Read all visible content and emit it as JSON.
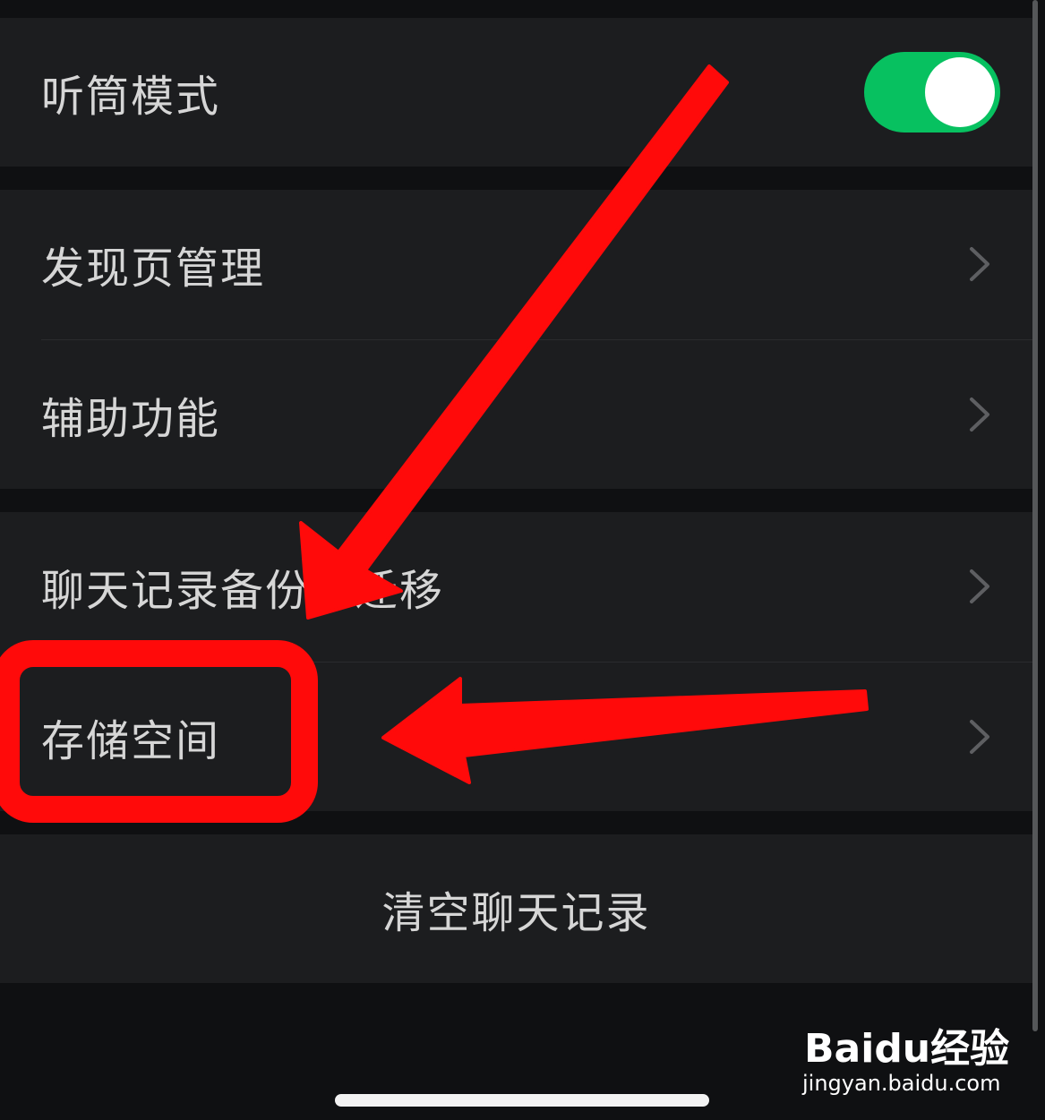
{
  "settings": {
    "earpiece_mode": {
      "label": "听筒模式",
      "toggle_on": true
    },
    "discover_page": {
      "label": "发现页管理"
    },
    "accessibility": {
      "label": "辅助功能"
    },
    "chat_backup": {
      "label": "聊天记录备份与迁移"
    },
    "storage": {
      "label": "存储空间"
    },
    "clear_history": {
      "label": "清空聊天记录"
    }
  },
  "watermark": {
    "logo_prefix": "Bai",
    "logo_paw": "du",
    "logo_suffix": "经验",
    "url": "jingyan.baidu.com"
  },
  "colors": {
    "background": "#0f1012",
    "cell": "#1c1d1f",
    "toggle_on": "#07c160",
    "annotation": "#ff0a0a"
  }
}
